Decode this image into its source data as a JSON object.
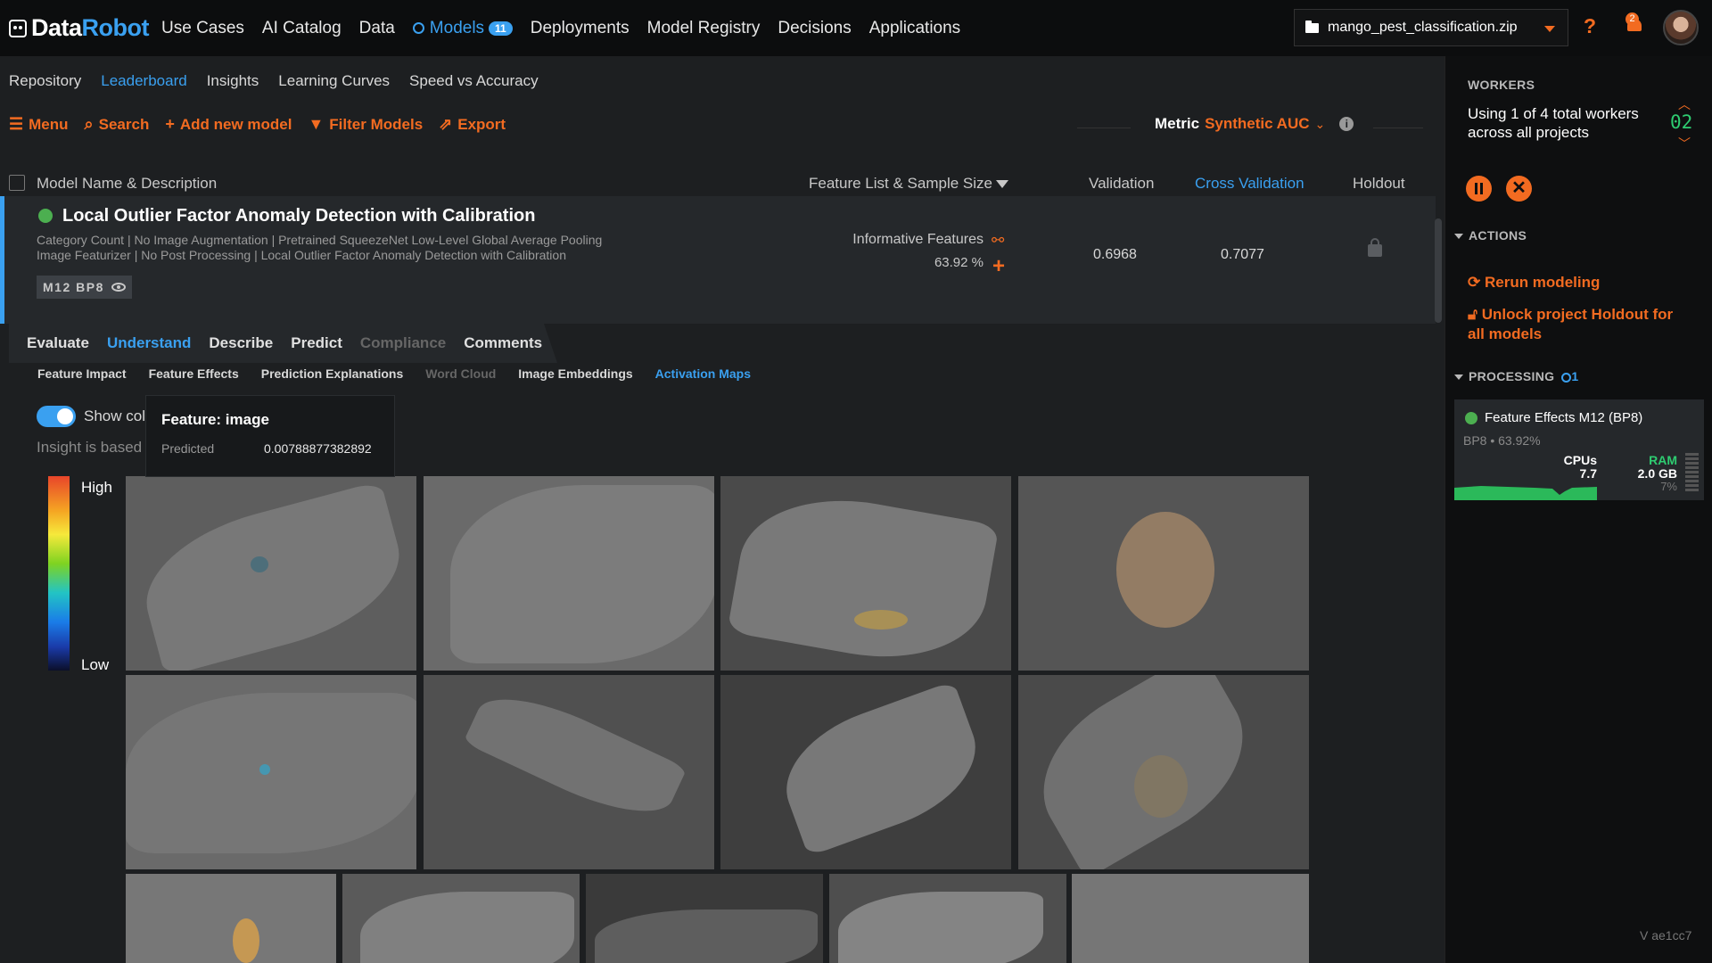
{
  "app": {
    "logo_part1": "Data",
    "logo_part2": "Robot",
    "nav": [
      "Use Cases",
      "AI Catalog",
      "Data",
      "Models",
      "Deployments",
      "Model Registry",
      "Decisions",
      "Applications"
    ],
    "models_badge": "11",
    "project": "mango_pest_classification.zip",
    "help": "?",
    "notifications": "2"
  },
  "subnav": [
    "Repository",
    "Leaderboard",
    "Insights",
    "Learning Curves",
    "Speed vs Accuracy"
  ],
  "toolbar": {
    "menu": "Menu",
    "search": "Search",
    "add_model": "Add new model",
    "filter": "Filter Models",
    "export": "Export",
    "metric_label": "Metric",
    "metric_value": "Synthetic AUC"
  },
  "table": {
    "col_model": "Model Name & Description",
    "col_feature": "Feature List & Sample Size",
    "col_validation": "Validation",
    "col_cv": "Cross Validation",
    "col_holdout": "Holdout"
  },
  "model": {
    "title": "Local Outlier Factor Anomaly Detection with Calibration",
    "desc_line1": "Category Count | No Image Augmentation | Pretrained SqueezeNet Low-Level Global Average Pooling",
    "desc_line2": "Image Featurizer | No Post Processing | Local Outlier Factor Anomaly Detection with Calibration",
    "badge": "M12  BP8",
    "feature_list": "Informative Features",
    "sample_pct": "63.92 %",
    "validation": "0.6968",
    "cross_validation": "0.7077"
  },
  "tabs": {
    "main": [
      "Evaluate",
      "Understand",
      "Describe",
      "Predict",
      "Compliance",
      "Comments"
    ],
    "sub": [
      "Feature Impact",
      "Feature Effects",
      "Prediction Explanations",
      "Word Cloud",
      "Image Embeddings",
      "Activation Maps"
    ]
  },
  "activation": {
    "toggle_label": "Show col",
    "insight_text": "Insight is based",
    "tooltip_title": "Feature: image",
    "tooltip_key": "Predicted",
    "tooltip_value": "0.00788877382892",
    "legend_high": "High",
    "legend_low": "Low"
  },
  "side": {
    "workers_title": "WORKERS",
    "workers_text": "Using 1 of 4 total workers across all projects",
    "workers_count": "02",
    "actions_title": "ACTIONS",
    "rerun": "Rerun modeling",
    "unlock": "Unlock project Holdout for all models",
    "processing_title": "PROCESSING",
    "processing_count": "1",
    "proc_title": "Feature Effects M12 (BP8)",
    "proc_sub": "BP8 • 63.92%",
    "cpu_label": "CPUs",
    "cpu_value": "7.7",
    "ram_label": "RAM",
    "ram_value": "2.0 GB",
    "ram_pct": "7%",
    "version": "V ae1cc7"
  },
  "colors": {
    "accent_blue": "#3aa0f0",
    "accent_orange": "#f26b21",
    "green": "#2ecc71"
  }
}
